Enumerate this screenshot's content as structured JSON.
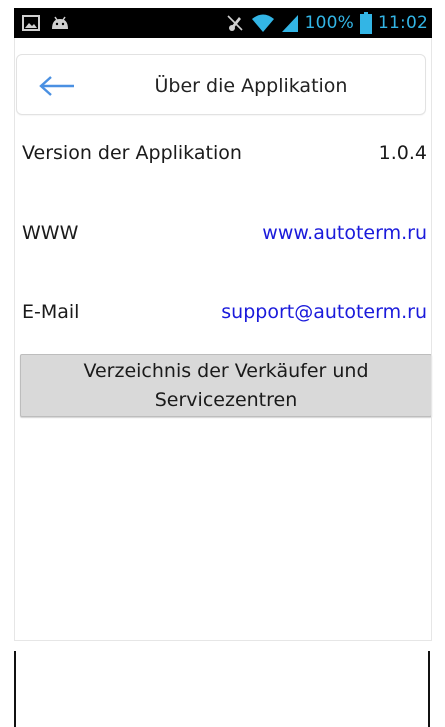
{
  "status_bar": {
    "battery_percent": "100%",
    "time": "11:02",
    "icons": [
      "gallery-icon",
      "android-icon",
      "mute-icon",
      "wifi-icon",
      "signal-icon",
      "battery-icon"
    ],
    "background_color": "#000000",
    "icon_color": "#33b5e5"
  },
  "app_bar": {
    "title": "Über die Applikation",
    "back_icon": "back-arrow-icon",
    "back_color": "#4a90e2"
  },
  "rows": {
    "version": {
      "label": "Version der Applikation",
      "value": "1.0.4"
    },
    "www": {
      "label": "WWW",
      "value": "www.autoterm.ru"
    },
    "email": {
      "label": "E-Mail",
      "value": "support@autoterm.ru"
    }
  },
  "dealer_button": {
    "label": "Verzeichnis der Verkäufer und Servicezentren"
  },
  "colors": {
    "link": "#1a1adb",
    "button_bg": "#d9d9d9"
  }
}
